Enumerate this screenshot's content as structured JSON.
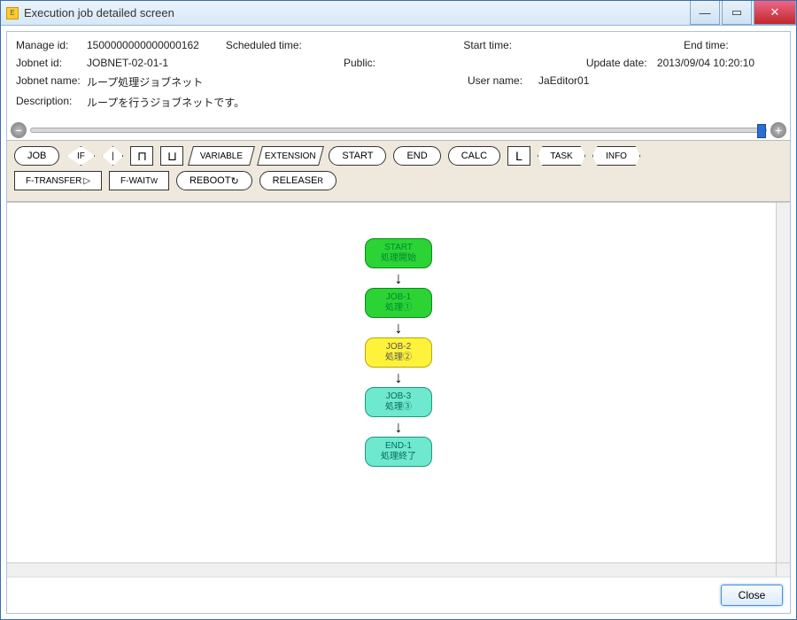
{
  "window": {
    "title": "Execution job detailed screen"
  },
  "info": {
    "manage_id_lbl": "Manage id:",
    "manage_id": "1500000000000000162",
    "scheduled_lbl": "Scheduled time:",
    "scheduled": "",
    "start_lbl": "Start time:",
    "start": "",
    "end_lbl": "End time:",
    "end": "",
    "jobnet_id_lbl": "Jobnet id:",
    "jobnet_id": "JOBNET-02-01-1",
    "public_lbl": "Public:",
    "public": "",
    "update_lbl": "Update date:",
    "update": "2013/09/04 10:20:10",
    "jobnet_name_lbl": "Jobnet name:",
    "jobnet_name": "ループ処理ジョブネット",
    "user_lbl": "User name:",
    "user": "JaEditor01",
    "desc_lbl": "Description:",
    "desc": "ループを行うジョブネットです。"
  },
  "palette": {
    "row1": [
      "JOB",
      "IF",
      "|",
      "⊓",
      "⊔",
      "VARIABLE",
      "EXTENSION",
      "START",
      "END",
      "CALC",
      "L",
      "TASK",
      "INFO"
    ],
    "row2": [
      "F-TRANSFER",
      "F-WAIT",
      "REBOOT",
      "RELEASE"
    ],
    "badges": {
      "fwait": "W",
      "release": "R",
      "reboot": "↻"
    }
  },
  "flow": [
    {
      "id": "START",
      "sub": "処理開始",
      "color": "green"
    },
    {
      "id": "JOB-1",
      "sub": "処理①",
      "color": "green"
    },
    {
      "id": "JOB-2",
      "sub": "処理②",
      "color": "yellow"
    },
    {
      "id": "JOB-3",
      "sub": "処理③",
      "color": "teal"
    },
    {
      "id": "END-1",
      "sub": "処理終了",
      "color": "teal"
    }
  ],
  "footer": {
    "close": "Close"
  }
}
